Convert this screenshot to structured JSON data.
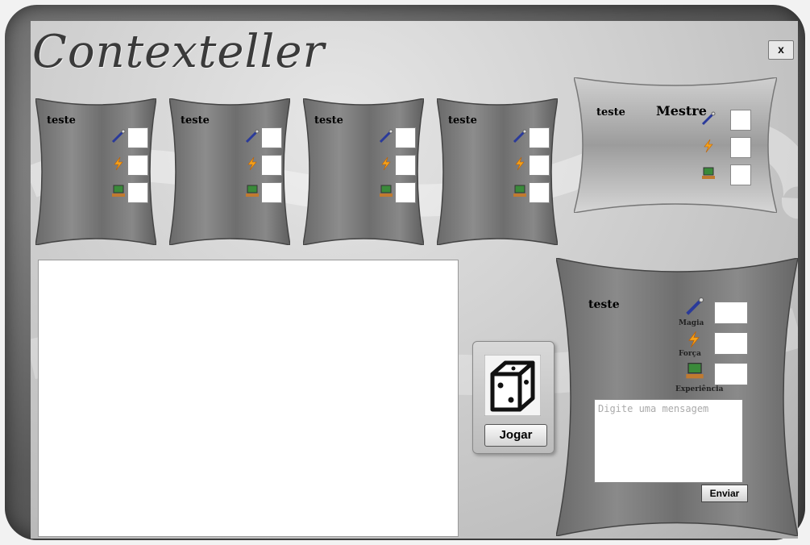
{
  "app": {
    "title": "Contexteller",
    "close_label": "x"
  },
  "players": [
    {
      "name": "teste"
    },
    {
      "name": "teste"
    },
    {
      "name": "teste"
    },
    {
      "name": "teste"
    }
  ],
  "master": {
    "name": "teste",
    "role_label": "Mestre"
  },
  "self_player": {
    "name": "teste",
    "stats": {
      "magic_label": "Magia",
      "strength_label": "Força",
      "experience_label": "Experiência"
    }
  },
  "icons": {
    "magic": "wand-icon",
    "strength": "lightning-icon",
    "experience": "computer-icon"
  },
  "dice": {
    "button_label": "Jogar"
  },
  "message": {
    "placeholder": "Digite uma mensagem",
    "send_label": "Enviar"
  },
  "colors": {
    "frame": "#5a5a5a",
    "panel": "#6e6e6e",
    "accent_magic": "#2a3a9a",
    "accent_strength": "#f4a21a"
  }
}
